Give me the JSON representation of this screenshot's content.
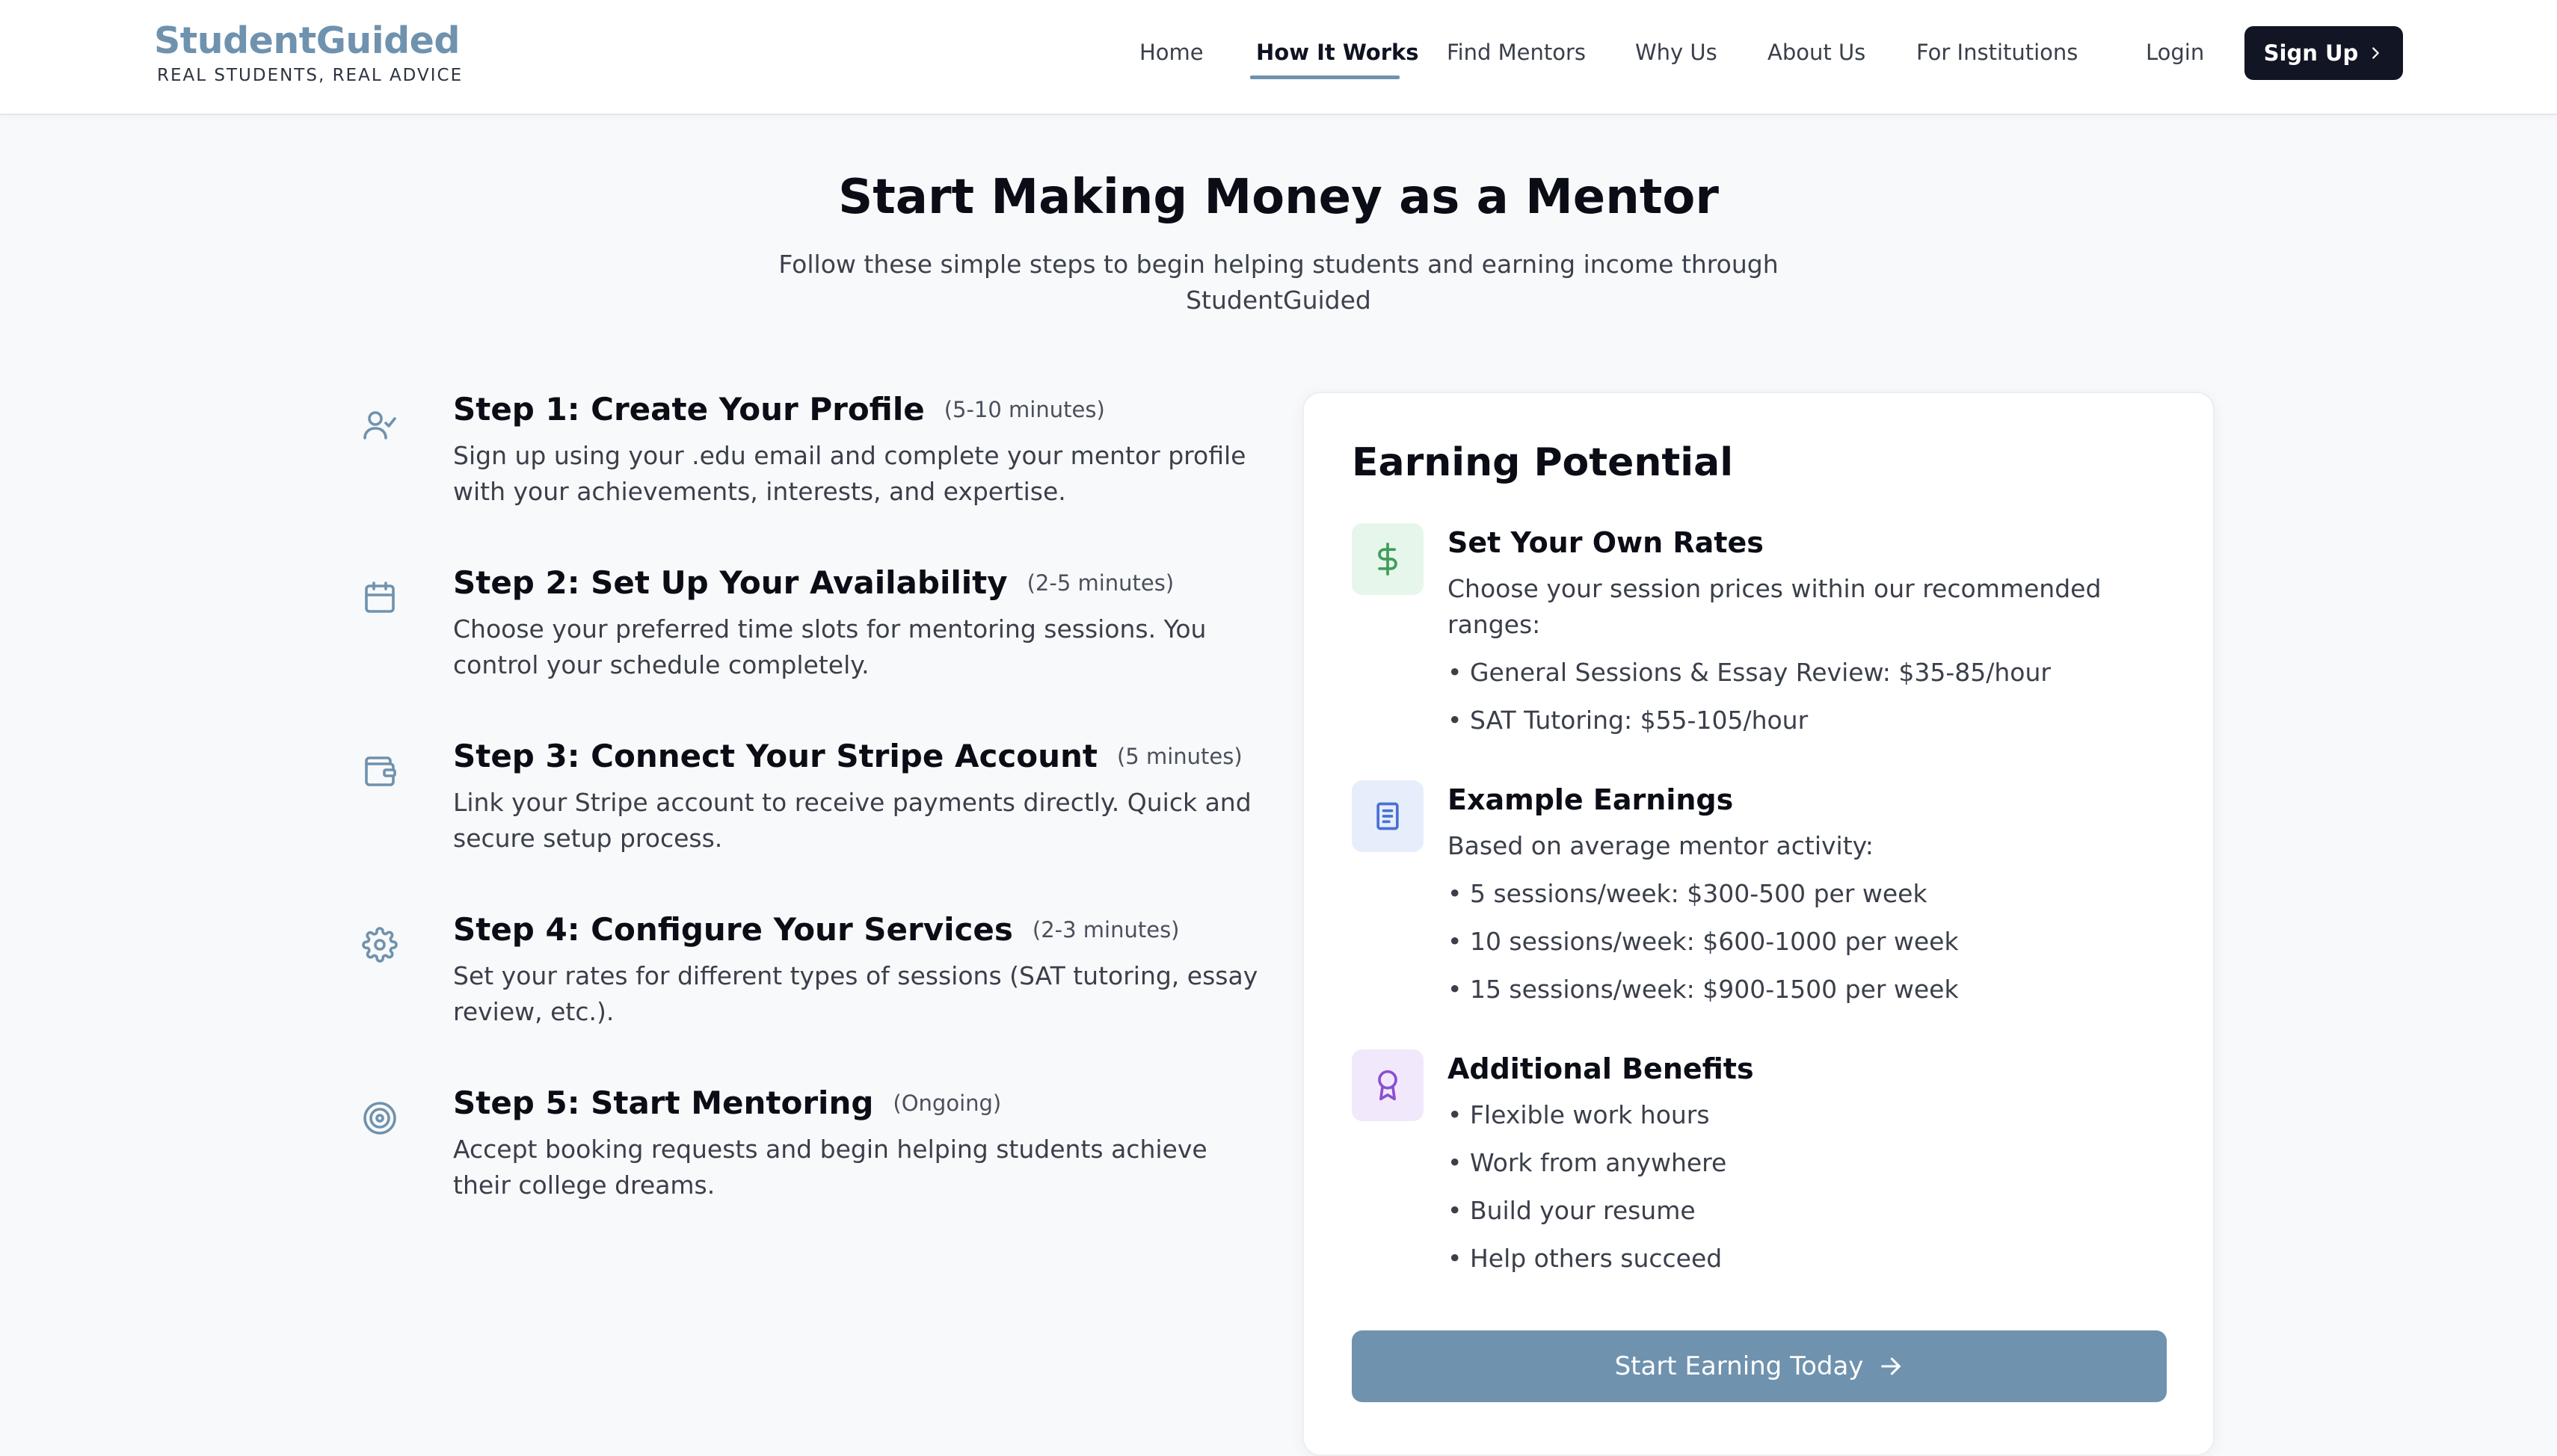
{
  "brand": {
    "name": "StudentGuided",
    "tagline": "REAL STUDENTS, REAL ADVICE"
  },
  "nav": {
    "links": [
      "Home",
      "How It Works",
      "Find Mentors",
      "Why Us",
      "About Us",
      "For Institutions"
    ],
    "active": "How It Works",
    "login": "Login",
    "signup": "Sign Up"
  },
  "hero": {
    "title": "Start Making Money as a Mentor",
    "subtitle": "Follow these simple steps to begin helping students and earning income through StudentGuided"
  },
  "steps": [
    {
      "icon": "user-check-icon",
      "title": "Step 1: Create Your Profile",
      "time": "(5-10 minutes)",
      "desc": "Sign up using your .edu email and complete your mentor profile with your achievements, interests, and expertise."
    },
    {
      "icon": "calendar-icon",
      "title": "Step 2: Set Up Your Availability",
      "time": "(2-5 minutes)",
      "desc": "Choose your preferred time slots for mentoring sessions. You control your schedule completely."
    },
    {
      "icon": "wallet-icon",
      "title": "Step 3: Connect Your Stripe Account",
      "time": "(5 minutes)",
      "desc": "Link your Stripe account to receive payments directly. Quick and secure setup process."
    },
    {
      "icon": "gear-icon",
      "title": "Step 4: Configure Your Services",
      "time": "(2-3 minutes)",
      "desc": "Set your rates for different types of sessions (SAT tutoring, essay review, etc.)."
    },
    {
      "icon": "target-icon",
      "title": "Step 5: Start Mentoring",
      "time": "(Ongoing)",
      "desc": "Accept booking requests and begin helping students achieve their college dreams."
    }
  ],
  "earning": {
    "title": "Earning Potential",
    "sections": [
      {
        "icon": "dollar-icon",
        "title": "Set Your Own Rates",
        "desc": "Choose your session prices within our recommended ranges:",
        "bullets": [
          "• General Sessions & Essay Review: $35-85/hour",
          "• SAT Tutoring: $55-105/hour"
        ]
      },
      {
        "icon": "book-icon",
        "title": "Example Earnings",
        "desc": "Based on average mentor activity:",
        "bullets": [
          "• 5 sessions/week: $300-500 per week",
          "• 10 sessions/week: $600-1000 per week",
          "• 15 sessions/week: $900-1500 per week"
        ]
      },
      {
        "icon": "award-icon",
        "title": "Additional Benefits",
        "desc": "",
        "bullets": [
          "• Flexible work hours",
          "• Work from anywhere",
          "• Build your resume",
          "• Help others succeed"
        ]
      }
    ],
    "cta": "Start Earning Today"
  },
  "colors": {
    "accent": "#6f92ae",
    "dark": "#111524",
    "green_bg": "#e6f6ea",
    "green": "#3f9d5a",
    "blue_bg": "#e6eefb",
    "blue": "#4a6fd6",
    "purple_bg": "#f1e8fb",
    "purple": "#8a4fd1"
  }
}
